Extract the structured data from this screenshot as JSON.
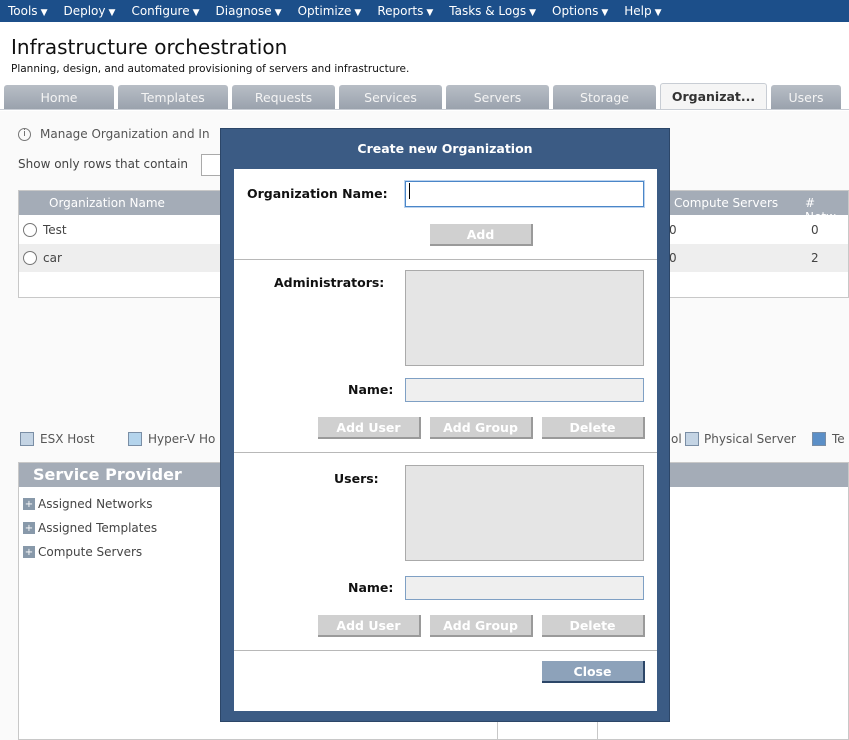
{
  "menu": {
    "items": [
      {
        "label": "Tools"
      },
      {
        "label": "Deploy"
      },
      {
        "label": "Configure"
      },
      {
        "label": "Diagnose"
      },
      {
        "label": "Optimize"
      },
      {
        "label": "Reports"
      },
      {
        "label": "Tasks & Logs"
      },
      {
        "label": "Options"
      },
      {
        "label": "Help"
      }
    ]
  },
  "header": {
    "title": "Infrastructure orchestration",
    "subtitle": "Planning, design, and automated provisioning of servers and infrastructure."
  },
  "tabs": [
    {
      "label": "Home"
    },
    {
      "label": "Templates"
    },
    {
      "label": "Requests"
    },
    {
      "label": "Services"
    },
    {
      "label": "Servers"
    },
    {
      "label": "Storage"
    },
    {
      "label": "Organizat..."
    },
    {
      "label": "Users"
    }
  ],
  "background": {
    "info_text": "Manage Organization and In",
    "filter_label": "Show only rows that contain",
    "grid": {
      "columns": [
        "Organization Name",
        "Compute Servers",
        "# Netw"
      ],
      "rows": [
        {
          "name": "Test",
          "servers": "0",
          "networks": "0"
        },
        {
          "name": "car",
          "servers": "0",
          "networks": "2"
        }
      ]
    },
    "legend": {
      "esx": "ESX Host",
      "hyperv": "Hyper-V Ho",
      "pool": "ol",
      "physical": "Physical Server",
      "te": "Te"
    },
    "service_provider": {
      "title": "Service Provider",
      "items": [
        "Assigned Networks",
        "Assigned Templates",
        "Compute Servers"
      ]
    }
  },
  "modal": {
    "title": "Create new Organization",
    "org_name_label": "Organization Name:",
    "org_name_value": "",
    "add_label": "Add",
    "admins_label": "Administrators:",
    "admin_name_label": "Name:",
    "admin_add_user": "Add User",
    "admin_add_group": "Add Group",
    "admin_delete": "Delete",
    "users_label": "Users:",
    "user_name_label": "Name:",
    "user_add_user": "Add User",
    "user_add_group": "Add Group",
    "user_delete": "Delete",
    "close_label": "Close"
  },
  "colors": {
    "menubar": "#1c4f8a",
    "modal_frame": "#3b5b84",
    "tab": "#a9b0ba"
  }
}
